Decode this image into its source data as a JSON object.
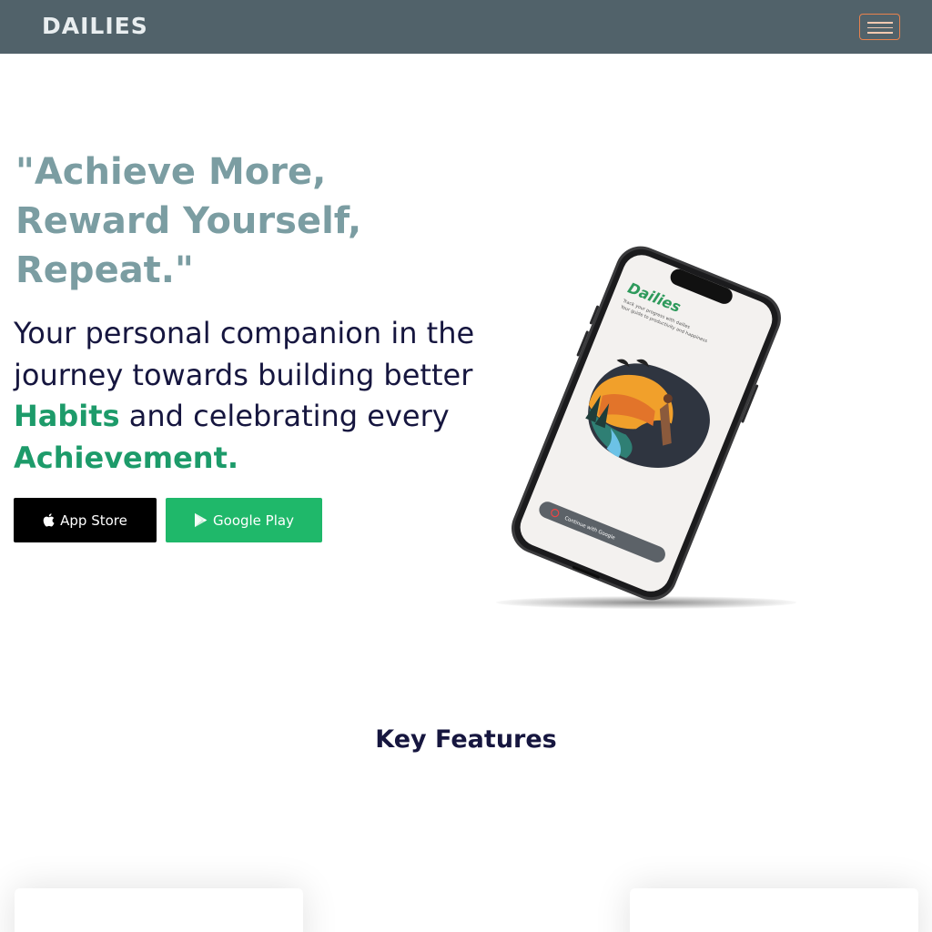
{
  "navbar": {
    "brand": "DAILIES"
  },
  "hero": {
    "tagline_lines": [
      "\"Achieve More,",
      "Reward Yourself,",
      "Repeat.\""
    ],
    "intro_line1": "Your personal companion in the",
    "intro_line2": "journey towards building better",
    "intro_habits": "Habits",
    "intro_mid": " and celebrating every",
    "intro_achievement": "Achievement.",
    "buttons": {
      "appstore_label": "App Store",
      "play_label": "Google Play"
    }
  },
  "phone_screen": {
    "app_title": "Dailies",
    "subtitle_line1": "Track your progress with dailies",
    "subtitle_line2": "Your guide to productivity and happiness",
    "continue_label": "Continue with Google"
  },
  "features": {
    "title": "Key Features"
  },
  "colors": {
    "navbar_bg": "#51626a",
    "tagline": "#7b9da2",
    "accent_green": "#1d9b6a",
    "play_button": "#1fb86a",
    "text_dark": "#16163f",
    "toggle_border": "#e8824e"
  }
}
